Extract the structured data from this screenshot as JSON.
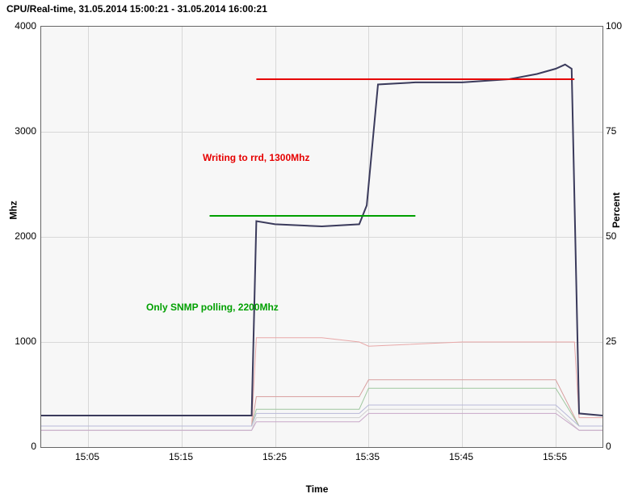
{
  "title": "CPU/Real-time, 31.05.2014 15:00:21 - 31.05.2014 16:00:21",
  "axes": {
    "left_label": "Mhz",
    "right_label": "Percent",
    "x_label": "Time",
    "y_left_ticks": [
      "0",
      "1000",
      "2000",
      "3000",
      "4000"
    ],
    "y_right_ticks": [
      "0",
      "25",
      "50",
      "75",
      "100"
    ],
    "x_ticks": [
      "15:05",
      "15:15",
      "15:25",
      "15:35",
      "15:45",
      "15:55"
    ]
  },
  "annotations": {
    "green": {
      "text": "Only SNMP polling, 2200Mhz",
      "color": "#00a000"
    },
    "red": {
      "text": "Writing to rrd, 1300Mhz",
      "color": "#e60000"
    }
  },
  "chart_data": {
    "type": "line",
    "title": "CPU/Real-time, 31.05.2014 15:00:21 - 31.05.2014 16:00:21",
    "x_domain_minutes": [
      0,
      60
    ],
    "xlabel": "Time",
    "left_axis": {
      "label": "Mhz",
      "range": [
        0,
        4000
      ]
    },
    "right_axis": {
      "label": "Percent",
      "range": [
        0,
        100
      ]
    },
    "reference_lines": [
      {
        "name": "snmp-polling",
        "axis": "left",
        "x_range_min": [
          18,
          40
        ],
        "y": 2200,
        "label": "Only SNMP polling, 2200Mhz",
        "color": "#00a000"
      },
      {
        "name": "writing-rrd",
        "axis": "left",
        "x_range_min": [
          23,
          57
        ],
        "y": 3500,
        "label": "Writing to rrd, 1300Mhz",
        "color": "#e60000"
      }
    ],
    "series": [
      {
        "name": "cpu-mhz",
        "axis": "left",
        "color": "#3b3b5c",
        "x_min": [
          0,
          22.5,
          23,
          25,
          30,
          34,
          34.8,
          36,
          40,
          45,
          50,
          53,
          55,
          56,
          56.7,
          57.5,
          60
        ],
        "y": [
          300,
          300,
          2150,
          2120,
          2100,
          2120,
          2300,
          3450,
          3470,
          3470,
          3500,
          3550,
          3600,
          3640,
          3600,
          320,
          300
        ]
      },
      {
        "name": "pct-a",
        "axis": "right",
        "color": "#e8a8a8",
        "x_min": [
          0,
          22.5,
          23,
          30,
          34,
          35,
          45,
          55,
          57,
          57.5,
          60
        ],
        "y": [
          5,
          5,
          26,
          26,
          25,
          24,
          25,
          25,
          25,
          7,
          7
        ]
      },
      {
        "name": "pct-b",
        "axis": "right",
        "color": "#d89f9f",
        "x_min": [
          0,
          22.5,
          23,
          34,
          35,
          55,
          57.5,
          60
        ],
        "y": [
          5,
          5,
          12,
          12,
          16,
          16,
          5,
          5
        ]
      },
      {
        "name": "pct-c",
        "axis": "right",
        "color": "#9fc79f",
        "x_min": [
          0,
          22.5,
          23,
          34,
          35,
          55,
          57.5,
          60
        ],
        "y": [
          5,
          5,
          9,
          9,
          14,
          14,
          5,
          5
        ]
      },
      {
        "name": "pct-d",
        "axis": "right",
        "color": "#b8b8d8",
        "x_min": [
          0,
          22.5,
          23,
          34,
          35,
          55,
          57.5,
          60
        ],
        "y": [
          5,
          5,
          8,
          8,
          10,
          10,
          5,
          5
        ]
      },
      {
        "name": "pct-e",
        "axis": "right",
        "color": "#cfcfcf",
        "x_min": [
          0,
          22.5,
          23,
          34,
          35,
          55,
          57.5,
          60
        ],
        "y": [
          4,
          4,
          7,
          7,
          9,
          9,
          4,
          4
        ]
      },
      {
        "name": "pct-f",
        "axis": "right",
        "color": "#c8a8c8",
        "x_min": [
          0,
          22.5,
          23,
          34,
          35,
          55,
          57.5,
          60
        ],
        "y": [
          4,
          4,
          6,
          6,
          8,
          8,
          4,
          4
        ]
      }
    ]
  }
}
